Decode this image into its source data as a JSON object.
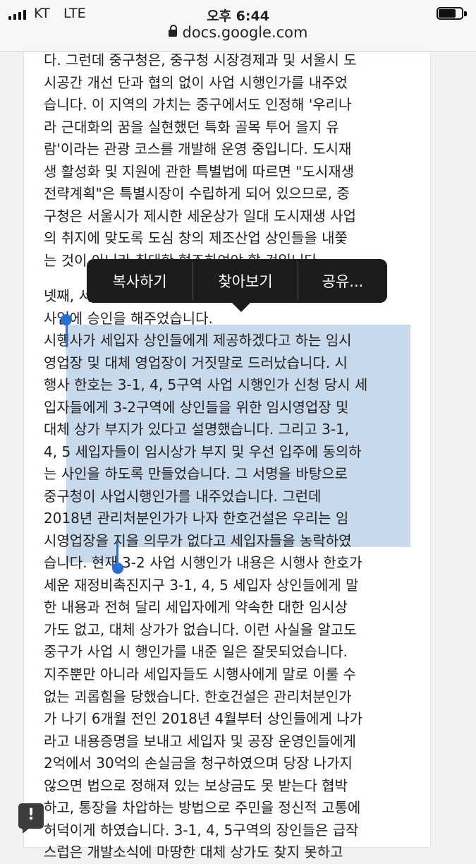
{
  "status_bar": {
    "carrier": "KT",
    "network": "LTE",
    "time": "오후 6:44"
  },
  "browser": {
    "url": "docs.google.com"
  },
  "document": {
    "paragraph1": [
      "다. 그런데 중구청은, 중구청 시장경제과 및 서울시 도",
      "시공간 개선 단과 협의 없이 사업 시행인가를 내주었",
      "습니다. 이 지역의 가치는 중구에서도 인정해 '우리나",
      "라 근대화의 꿈을 실현했던 특화 골목 투어 을지 유",
      "람'이라는 관광 코스를 개발해 운영 중입니다. 도시재",
      "생 활성화 및 지원에 관한 특별법에 따르면 \"도시재생",
      "전략계획\"은 특별시장이 수립하게 되어 있으므로, 중",
      "구청은 서울시가 제시한 세운상가 일대 도시재생 사업",
      "의 취지에 맞도록 도심 창의 제조산업 상인들을 내쫓",
      "는 것이 아니라 최대한 협조하여야 할 것입니다."
    ],
    "paragraph2": [
      "넷째,                                                          서도",
      "사업에 승인을 해주었습니다.",
      "시행사가 세입자 상인들에게 제공하겠다고 하는 임시",
      "영업장 및 대체 영업장이 거짓말로 드러났습니다. 시",
      "행사 한호는 3-1, 4, 5구역 사업 시행인가 신청 당시 세",
      "입자들에게 3-2구역에 상인들을 위한 임시영업장 및",
      "대체 상가 부지가 있다고 설명했습니다. 그리고 3-1,",
      "4, 5 세입자들이 임시상가 부지 및 우선 입주에 동의하",
      "는 사인을 하도록 만들었습니다. 그 서명을 바탕으로",
      "중구청이 사업시행인가를 내주었습니다.  그런데",
      "2018년 관리처분인가가 나자 한호건설은 우리는 임",
      "시영업장을 지을 의무가 없다고 세입자들을 농락하였",
      "습니다.  현재 3-2 사업 시행인가 내용은 시행사 한호가",
      "세운 재정비촉진지구 3-1, 4, 5 세입자 상인들에게 말",
      "한 내용과 전혀 달리 세입자에게 약속한 대한 임시상",
      "가도 없고, 대체 상가가 없습니다. 이런 사실을 알고도",
      "중구가 사업 시 행인가를 내준 일은 잘못되었습니다."
    ],
    "paragraph3": [
      "지주뿐만 아니라 세입자들도 시행사에게 말로 이룰 수",
      "없는 괴롭힘을 당했습니다. 한호건설은 관리처분인가",
      "가 나기 6개월 전인 2018년 4월부터 상인들에게 나가",
      "라고 내용증명을 보내고 세입자 및 공장 운영인들에게",
      "2억에서 30억의 손실금을 청구하였으며 당장 나가지",
      "않으면 법으로 정해져 있는 보상금도 못 받는다 협박",
      "하고, 통장을 차압하는 방법으로 주민을 정신적 고통에",
      "허덕이게 하였습니다. 3-1, 4, 5구역의 장인들은 급작",
      "스럽은 개발소식에 마땅한 대체 상가도 찾지 못하고"
    ]
  },
  "context_menu": {
    "items": [
      "복사하기",
      "찾아보기",
      "공유..."
    ]
  },
  "feedback_button": {
    "label": "!"
  },
  "colors": {
    "selection": "#c9d9ec",
    "handle": "#2a6fd6",
    "menu_bg": "#1c1c1c"
  }
}
